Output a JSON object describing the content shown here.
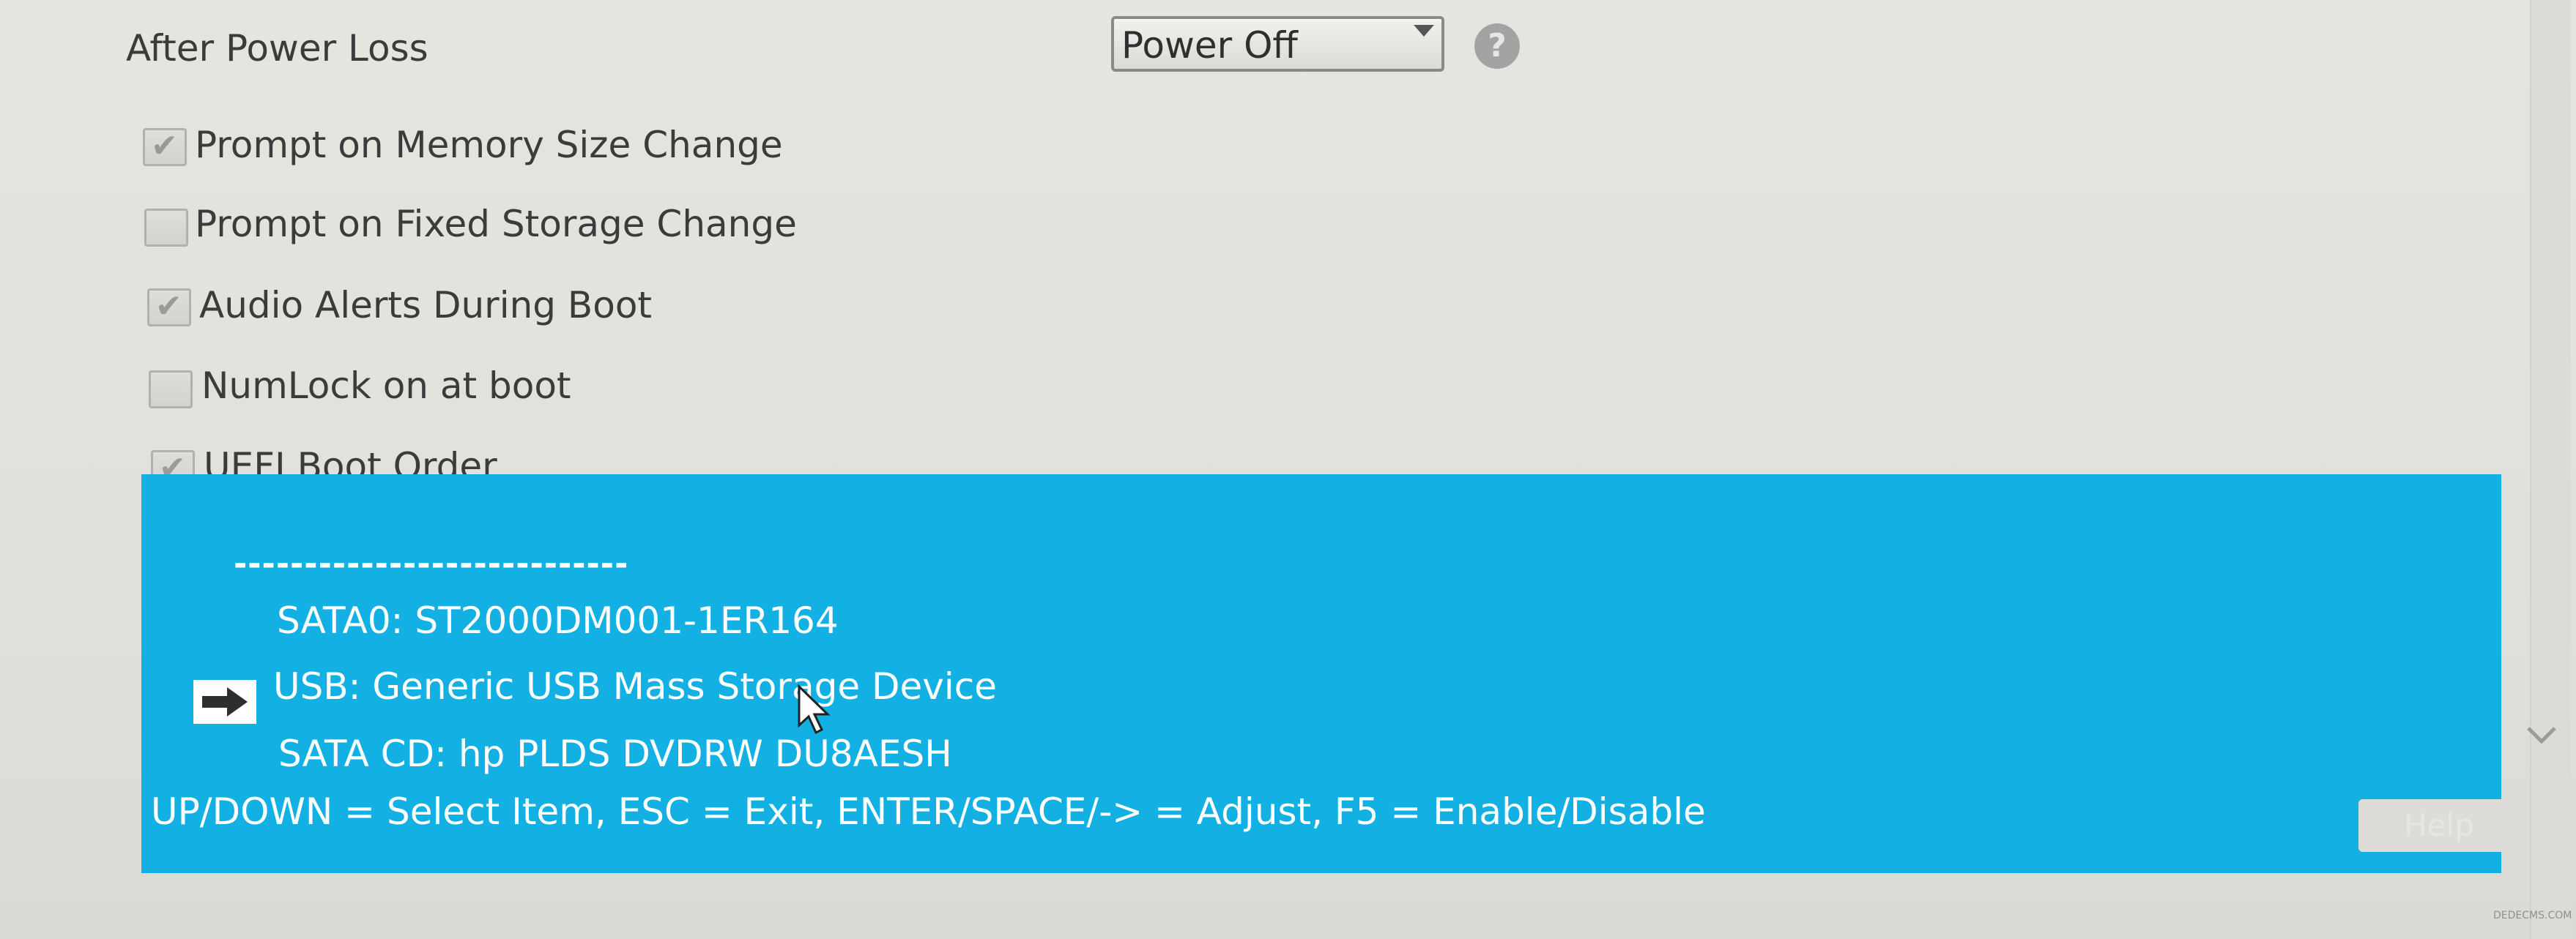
{
  "settings": {
    "after_power_loss_label": "After Power Loss",
    "after_power_loss_value": "Power Off",
    "help_icon": "question-circle-icon",
    "checkboxes": [
      {
        "label": "Prompt on Memory Size Change",
        "checked": true
      },
      {
        "label": "Prompt on Fixed Storage Change",
        "checked": false
      },
      {
        "label": "Audio Alerts During Boot",
        "checked": true
      },
      {
        "label": "NumLock on at boot",
        "checked": false
      },
      {
        "label": "UEFI Boot Order",
        "checked": true
      }
    ]
  },
  "boot_order": {
    "divider": "----------------------------",
    "items": [
      {
        "label": "SATA0:  ST2000DM001-1ER164",
        "selected": false
      },
      {
        "label": "USB:  Generic USB Mass Storage Device",
        "selected": true
      },
      {
        "label": "SATA CD:  hp PLDS DVDRW DU8AESH",
        "selected": false
      }
    ],
    "hint": "UP/DOWN = Select Item,  ESC = Exit,  ENTER/SPACE/-> = Adjust, F5 = Enable/Disable",
    "panel_color": "#13b1e3",
    "selection_icon": "right-arrow-icon"
  },
  "right_button_label": "Help",
  "watermark": "DEDECMS.COM"
}
